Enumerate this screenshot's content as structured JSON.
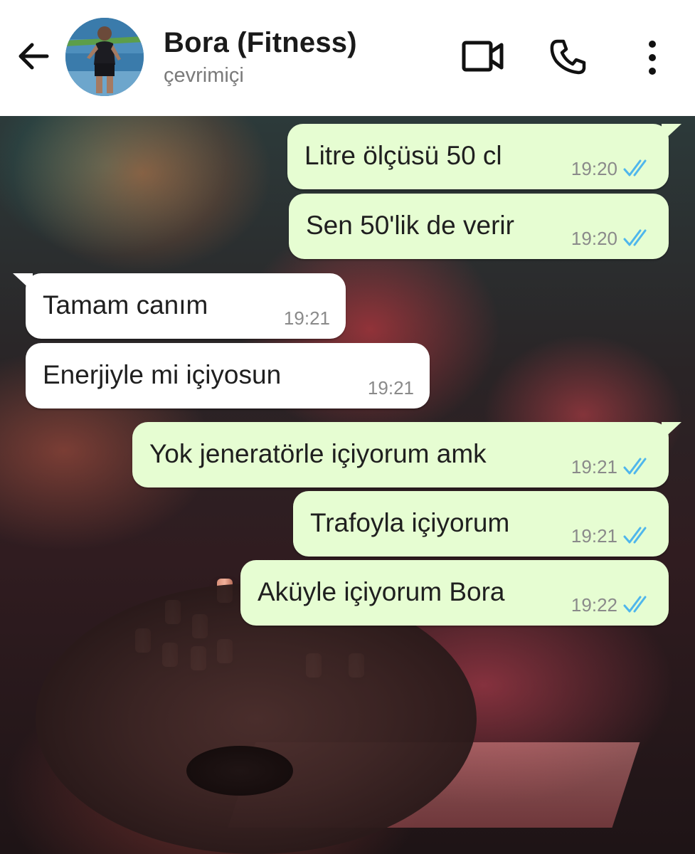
{
  "header": {
    "contact_name": "Bora (Fitness)",
    "status": "çevrimiçi"
  },
  "messages": [
    {
      "direction": "out",
      "text": "Litre ölçüsü 50 cl",
      "time": "19:20",
      "read": true
    },
    {
      "direction": "out",
      "text": "Sen 50'lik de verir",
      "time": "19:20",
      "read": true
    },
    {
      "direction": "in",
      "text": "Tamam canım",
      "time": "19:21"
    },
    {
      "direction": "in",
      "text": "Enerjiyle mi içiyosun",
      "time": "19:21"
    },
    {
      "direction": "out",
      "text": "Yok jeneratörle içiyorum amk",
      "time": "19:21",
      "read": true
    },
    {
      "direction": "out",
      "text": "Trafoyla içiyorum",
      "time": "19:21",
      "read": true
    },
    {
      "direction": "out",
      "text": "Aküyle içiyorum Bora",
      "time": "19:22",
      "read": true
    }
  ],
  "icons": {
    "back": "arrow-left-icon",
    "video_call": "video-camera-icon",
    "voice_call": "phone-icon",
    "menu": "more-vertical-icon",
    "read_receipt": "double-check-icon"
  },
  "colors": {
    "outgoing_bubble": "#e6fdd2",
    "incoming_bubble": "#ffffff",
    "read_tick": "#4fb6ec"
  }
}
